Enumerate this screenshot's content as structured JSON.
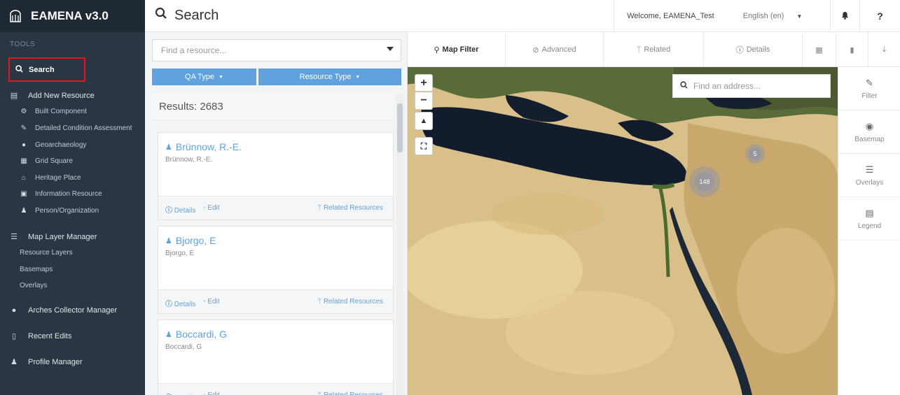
{
  "app": {
    "title": "EAMENA v3.0"
  },
  "sidebar": {
    "tools_label": "TOOLS",
    "search": "Search",
    "add_new_resource": "Add New Resource",
    "resources": [
      "Built Component",
      "Detailed Condition Assessment",
      "Geoarchaeology",
      "Grid Square",
      "Heritage Place",
      "Information Resource",
      "Person/Organization"
    ],
    "map_layer_manager": "Map Layer Manager",
    "layers": [
      "Resource Layers",
      "Basemaps",
      "Overlays"
    ],
    "arches_collector_manager": "Arches Collector Manager",
    "recent_edits": "Recent Edits",
    "profile_manager": "Profile Manager"
  },
  "header": {
    "page_title": "Search",
    "welcome": "Welcome, EAMENA_Test",
    "language": "English (en)",
    "help": "?"
  },
  "search_panel": {
    "find_placeholder": "Find a resource...",
    "filter_qa": "QA Type",
    "filter_resource": "Resource Type",
    "results": "Results: 2683",
    "cards": [
      {
        "name": "Brünnow, R.-E.",
        "subtitle": "Brünnow, R.-E."
      },
      {
        "name": "Bjorgo, E",
        "subtitle": "Bjorgo, E"
      },
      {
        "name": "Boccardi, G",
        "subtitle": "Boccardi, G"
      }
    ],
    "card_details": "Details",
    "card_edit": "Edit",
    "card_related": "Related Resources"
  },
  "map_tabs": {
    "map_filter": "Map Filter",
    "advanced": "Advanced",
    "related": "Related",
    "details": "Details"
  },
  "map": {
    "address_placeholder": "Find an address...",
    "zoom_in": "+",
    "zoom_out": "−",
    "clusters": [
      {
        "count": "148"
      },
      {
        "count": "5"
      }
    ]
  },
  "right_panel": {
    "filter": "Filter",
    "basemap": "Basemap",
    "overlays": "Overlays",
    "legend": "Legend"
  },
  "colors": {
    "sidebar_bg": "#2a3642",
    "accent": "#5fa2dd",
    "highlight_border": "#e0161d"
  }
}
